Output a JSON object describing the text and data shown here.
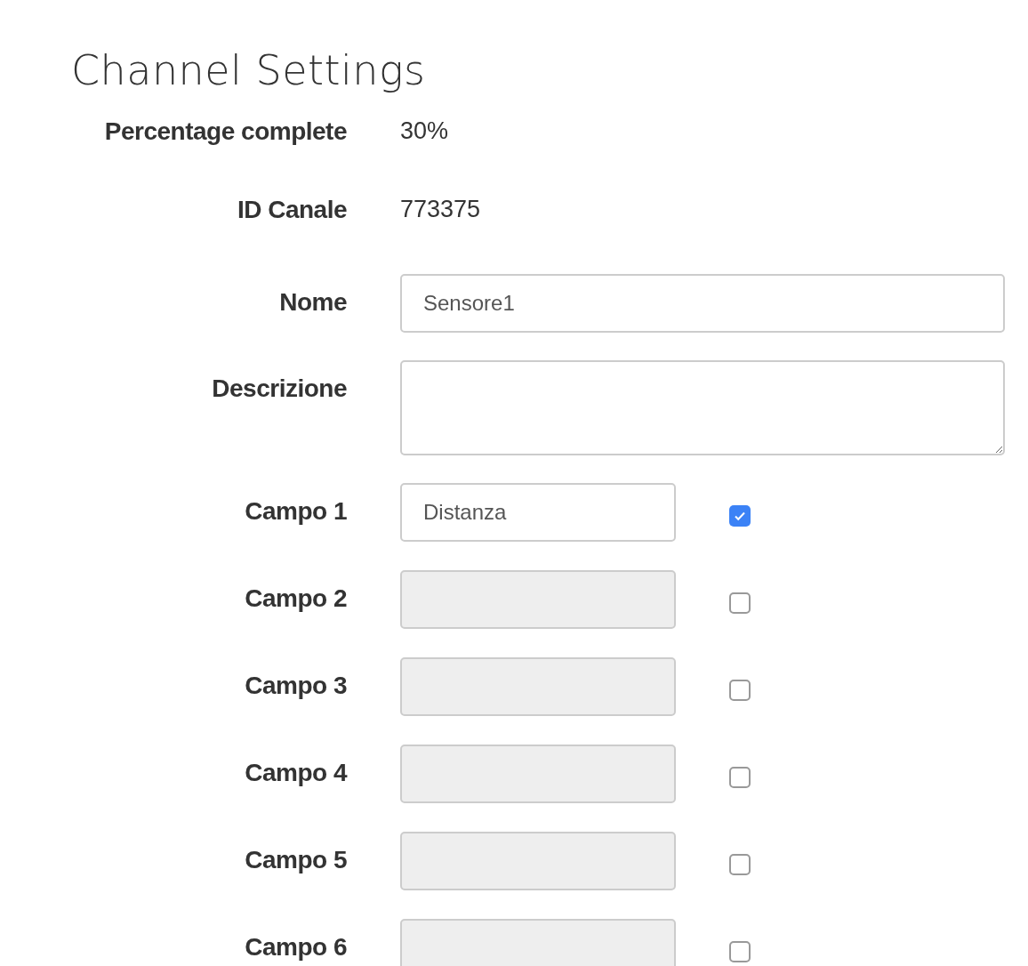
{
  "title": "Channel Settings",
  "info": [
    {
      "label": "Percentage complete",
      "value": "30%"
    },
    {
      "label": "ID Canale",
      "value": "773375"
    }
  ],
  "name_field": {
    "label": "Nome",
    "value": "Sensore1"
  },
  "description_field": {
    "label": "Descrizione"
  },
  "fields": [
    {
      "label": "Campo 1",
      "value": "Distanza",
      "disabled": false,
      "checked": true
    },
    {
      "label": "Campo 2",
      "disabled": true,
      "checked": false
    },
    {
      "label": "Campo 3",
      "disabled": true,
      "checked": false
    },
    {
      "label": "Campo 4",
      "disabled": true,
      "checked": false
    },
    {
      "label": "Campo 5",
      "disabled": true,
      "checked": false
    },
    {
      "label": "Campo 6",
      "disabled": true,
      "checked": false
    }
  ]
}
